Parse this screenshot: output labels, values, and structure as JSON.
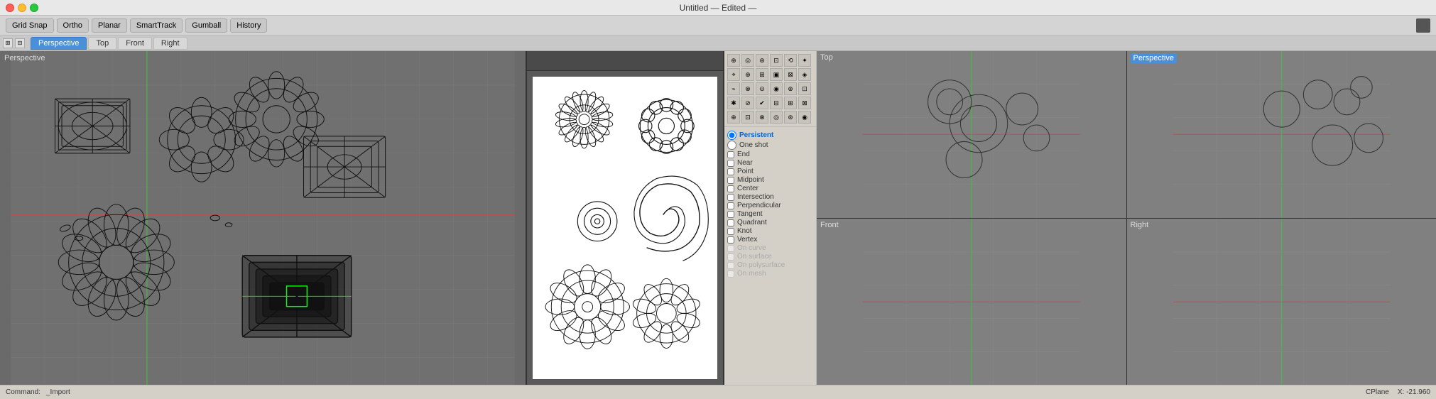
{
  "titlebar": {
    "title": "Untitled — Edited —"
  },
  "toolbar": {
    "grid_snap": "Grid Snap",
    "ortho": "Ortho",
    "planar": "Planar",
    "smart_track": "SmartTrack",
    "gumball": "Gumball",
    "history": "History"
  },
  "view_tabs": {
    "perspective": "Perspective",
    "top": "Top",
    "front": "Front",
    "right": "Right"
  },
  "viewports": {
    "top_label": "Top",
    "front_label": "Front",
    "right_label": "Right",
    "perspective_label": "Perspective"
  },
  "snap": {
    "persistent_label": "Persistent",
    "one_shot_label": "One shot",
    "items": [
      {
        "label": "End",
        "checked": false
      },
      {
        "label": "Near",
        "checked": false
      },
      {
        "label": "Point",
        "checked": false
      },
      {
        "label": "Midpoint",
        "checked": false
      },
      {
        "label": "Center",
        "checked": false
      },
      {
        "label": "Intersection",
        "checked": false
      },
      {
        "label": "Perpendicular",
        "checked": false
      },
      {
        "label": "Tangent",
        "checked": false
      },
      {
        "label": "Quadrant",
        "checked": false
      },
      {
        "label": "Knot",
        "checked": false
      },
      {
        "label": "Vertex",
        "checked": false
      },
      {
        "label": "On curve",
        "checked": false,
        "disabled": true
      },
      {
        "label": "On surface",
        "checked": false,
        "disabled": true
      },
      {
        "label": "On polysurface",
        "checked": false,
        "disabled": true
      },
      {
        "label": "On mesh",
        "checked": false,
        "disabled": true
      }
    ]
  },
  "statusbar": {
    "command_label": "Command:",
    "command_value": "_Import",
    "cplane": "CPlane",
    "x_coord": "X: -21.960"
  }
}
